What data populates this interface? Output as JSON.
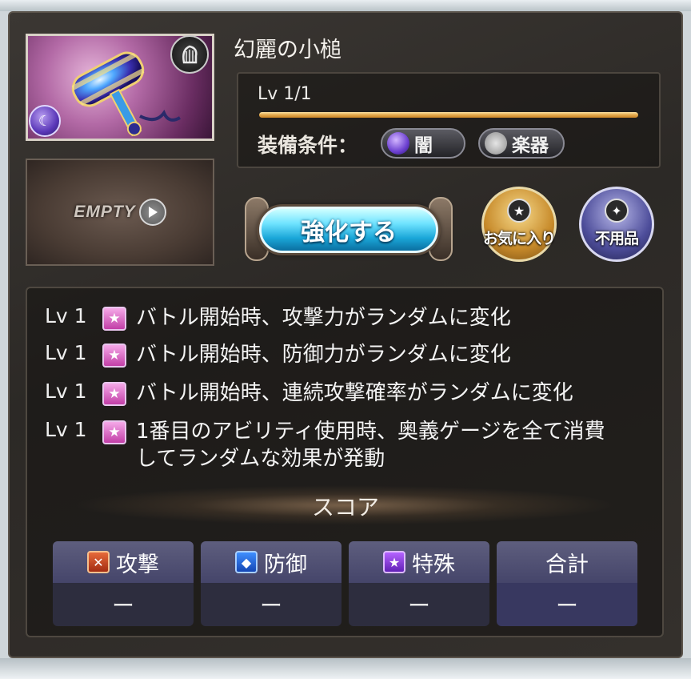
{
  "weapon": {
    "name": "幻麗の小槌",
    "level_text": "Lv 1/1",
    "level_fill": 1.0,
    "element_icon": "dark-element-icon",
    "type_icon": "harp-icon"
  },
  "skin_slot": {
    "label": "EMPTY",
    "icon": "play-icon"
  },
  "equip": {
    "label": "装備条件：",
    "conditions": [
      {
        "label": "闇",
        "icon": "dark-element-icon"
      },
      {
        "label": "楽器",
        "icon": "instrument-icon"
      }
    ]
  },
  "actions": {
    "enhance_label": "強化する",
    "favorite_label": "お気に入り",
    "junk_label": "不用品"
  },
  "skills": [
    {
      "lv": "Lv 1",
      "text": "バトル開始時、攻撃力がランダムに変化"
    },
    {
      "lv": "Lv 1",
      "text": "バトル開始時、防御力がランダムに変化"
    },
    {
      "lv": "Lv 1",
      "text": "バトル開始時、連続攻撃確率がランダムに変化"
    },
    {
      "lv": "Lv 1",
      "text": "1番目のアビリティ使用時、奥義ゲージを全て消費してランダムな効果が発動"
    }
  ],
  "score": {
    "title": "スコア",
    "columns": [
      {
        "label": "攻撃",
        "value": "ー",
        "icon": "attack-icon"
      },
      {
        "label": "防御",
        "value": "ー",
        "icon": "defense-icon"
      },
      {
        "label": "特殊",
        "value": "ー",
        "icon": "special-icon"
      },
      {
        "label": "合計",
        "value": "ー"
      }
    ]
  },
  "colors": {
    "accent_gold": "#e3a84c",
    "enhance_blue": "#1aa6d8",
    "skill_pink": "#c23fa7"
  }
}
